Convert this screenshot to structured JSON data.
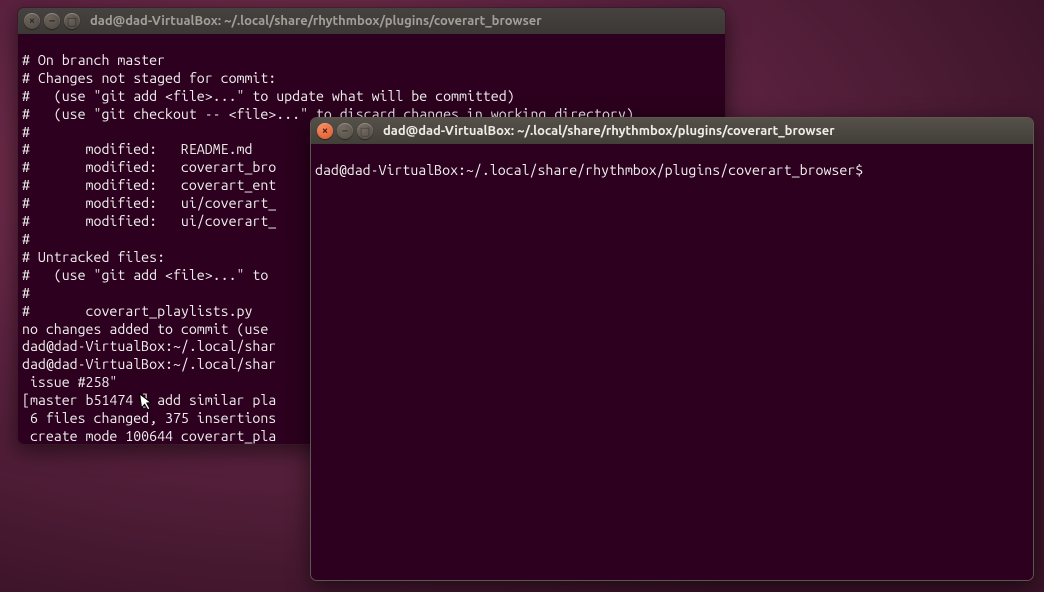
{
  "back_window": {
    "title": "dad@dad-VirtualBox: ~/.local/share/rhythmbox/plugins/coverart_browser",
    "close_glyph": "×",
    "min_glyph": "–",
    "max_glyph": "□",
    "lines": {
      "l0": "# On branch master",
      "l1": "# Changes not staged for commit:",
      "l2": "#   (use \"git add <file>...\" to update what will be committed)",
      "l3": "#   (use \"git checkout -- <file>...\" to discard changes in working directory)",
      "l4": "#",
      "l5": "#       modified:   README.md",
      "l6": "#       modified:   coverart_bro",
      "l7": "#       modified:   coverart_ent",
      "l8": "#       modified:   ui/coverart_",
      "l9": "#       modified:   ui/coverart_",
      "l10": "#",
      "l11": "# Untracked files:",
      "l12": "#   (use \"git add <file>...\" to ",
      "l13": "#",
      "l14": "#       coverart_playlists.py",
      "l15": "no changes added to commit (use ",
      "l16": "dad@dad-VirtualBox:~/.local/shar",
      "l17": "dad@dad-VirtualBox:~/.local/shar",
      "l18": " issue #258\"",
      "l19": "[master b51474 ] add similar pla",
      "l20": " 6 files changed, 375 insertions",
      "l21": " create mode 100644 coverart_pla"
    }
  },
  "front_window": {
    "title": "dad@dad-VirtualBox: ~/.local/share/rhythmbox/plugins/coverart_browser",
    "close_glyph": "×",
    "min_glyph": "–",
    "max_glyph": "□",
    "prompt": "dad@dad-VirtualBox:~/.local/share/rhythmbox/plugins/coverart_browser$ "
  },
  "cursor_glyph": "↖"
}
